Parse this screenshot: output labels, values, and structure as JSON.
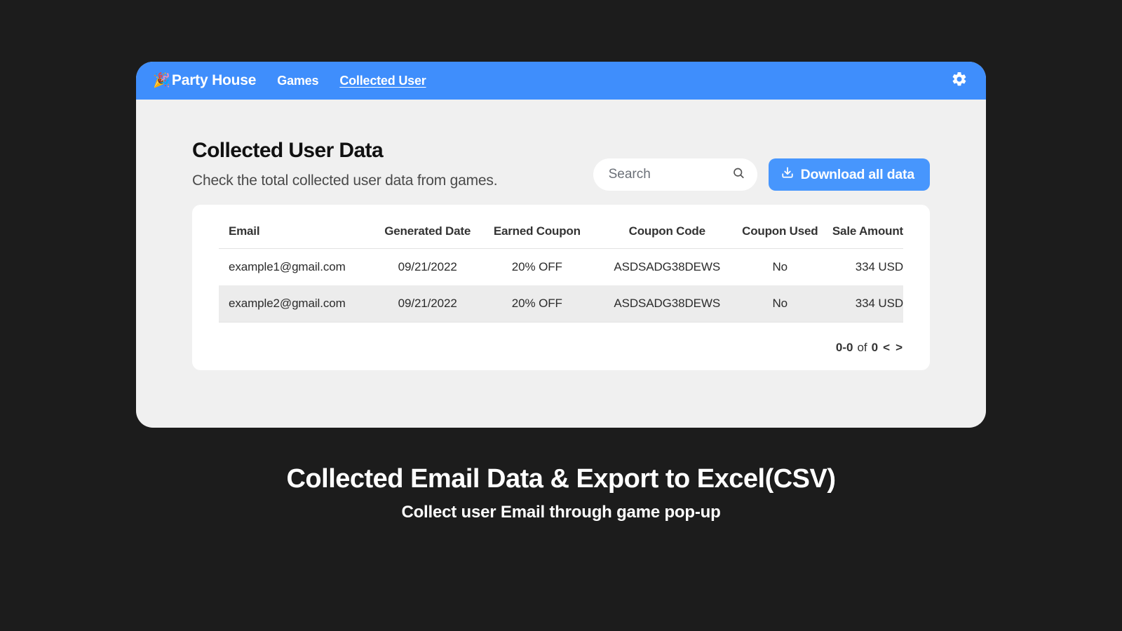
{
  "brand": {
    "icon": "🎉",
    "name": "Party House"
  },
  "nav": {
    "games": "Games",
    "collected_user": "Collected User"
  },
  "page": {
    "title": "Collected User Data",
    "subtitle": "Check the total collected user data from games."
  },
  "search": {
    "placeholder": "Search"
  },
  "download": {
    "label": "Download all data"
  },
  "table": {
    "headers": {
      "email": "Email",
      "date": "Generated Date",
      "coupon": "Earned Coupon",
      "code": "Coupon Code",
      "used": "Coupon Used",
      "amount": "Sale Amount"
    },
    "rows": [
      {
        "email": "example1@gmail.com",
        "date": "09/21/2022",
        "coupon": "20% OFF",
        "code": "ASDSADG38DEWS",
        "used": "No",
        "amount": "334 USD"
      },
      {
        "email": "example2@gmail.com",
        "date": "09/21/2022",
        "coupon": "20% OFF",
        "code": "ASDSADG38DEWS",
        "used": "No",
        "amount": "334 USD"
      }
    ]
  },
  "pager": {
    "range": "0-0",
    "of": "of",
    "total": "0"
  },
  "hero": {
    "title": "Collected Email Data & Export to Excel(CSV)",
    "subtitle": "Collect user Email through game pop-up"
  },
  "colors": {
    "accent": "#3f8efc",
    "button": "#4796fd"
  }
}
